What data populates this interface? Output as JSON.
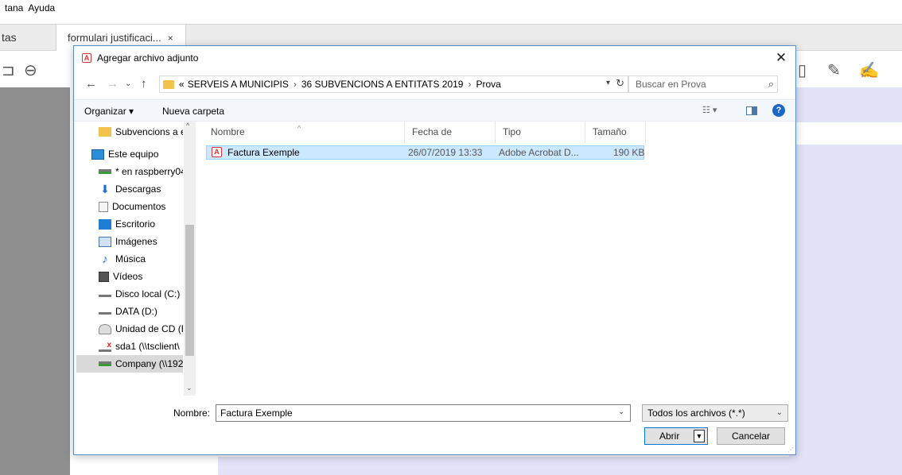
{
  "background": {
    "menu": [
      "tana",
      "Ayuda"
    ],
    "tab_left": "tas",
    "tab_active": "formulari justificaci...",
    "tab_close": "×"
  },
  "dialog": {
    "title": "Agregar archivo adjunto",
    "close": "✕",
    "breadcrumb": [
      "«",
      "SERVEIS A MUNICIPIS",
      "36 SUBVENCIONS A ENTITATS 2019",
      "Prova"
    ],
    "search_placeholder": "Buscar en Prova",
    "commands": {
      "organize": "Organizar ▾",
      "new_folder": "Nueva carpeta",
      "help": "?"
    },
    "nav_items": [
      {
        "label": "Subvencions a e",
        "icon": "folder-icon",
        "indent": 1
      },
      {
        "label": "Este equipo",
        "icon": "computer-icon",
        "indent": 0
      },
      {
        "label": "* en raspberry04",
        "icon": "network-drive-icon",
        "indent": 1
      },
      {
        "label": "Descargas",
        "icon": "download-icon",
        "indent": 1
      },
      {
        "label": "Documentos",
        "icon": "documents-icon",
        "indent": 1
      },
      {
        "label": "Escritorio",
        "icon": "desktop-icon",
        "indent": 1
      },
      {
        "label": "Imágenes",
        "icon": "pictures-icon",
        "indent": 1
      },
      {
        "label": "Música",
        "icon": "music-icon",
        "indent": 1
      },
      {
        "label": "Vídeos",
        "icon": "videos-icon",
        "indent": 1
      },
      {
        "label": "Disco local (C:)",
        "icon": "disk-icon",
        "indent": 1
      },
      {
        "label": "DATA (D:)",
        "icon": "disk-icon",
        "indent": 1
      },
      {
        "label": "Unidad de CD (E",
        "icon": "cd-icon",
        "indent": 1
      },
      {
        "label": "sda1 (\\\\tsclient\\",
        "icon": "disconnected-drive-icon",
        "indent": 1
      },
      {
        "label": "Company (\\\\192",
        "icon": "network-drive-icon",
        "indent": 1,
        "selected": true
      }
    ],
    "columns": [
      "Nombre",
      "Fecha de modifica...",
      "Tipo",
      "Tamaño"
    ],
    "files": [
      {
        "name": "Factura Exemple",
        "date": "26/07/2019 13:33",
        "type": "Adobe Acrobat D...",
        "size": "190 KB"
      }
    ],
    "filename_label": "Nombre:",
    "filename_value": "Factura Exemple",
    "filter": "Todos los archivos (*.*)",
    "open": "Abrir",
    "cancel": "Cancelar"
  },
  "colors": {
    "accent": "#0078d7",
    "selection": "#cce8ff",
    "lavender": "#e3e3f8",
    "panel_gray": "#8f8f8f"
  }
}
